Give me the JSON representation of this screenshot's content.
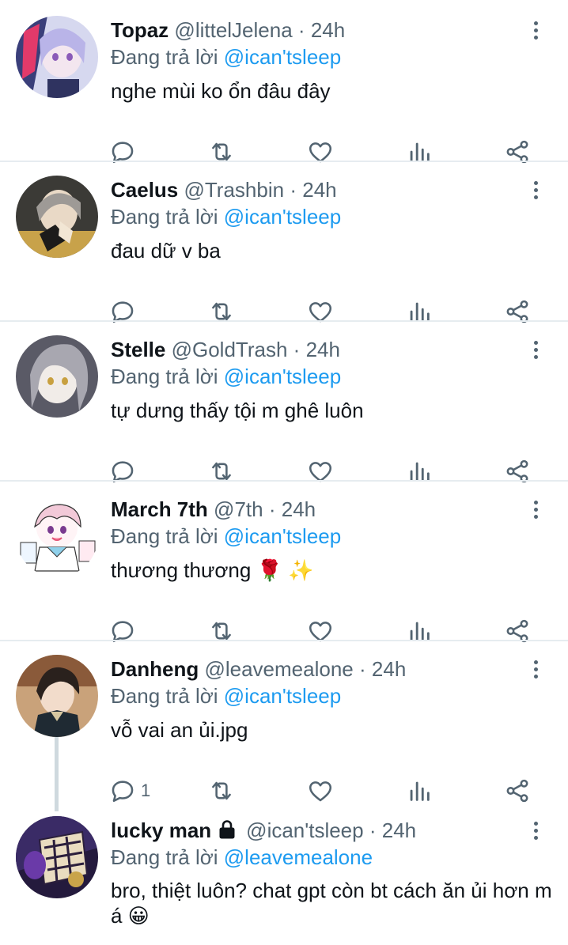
{
  "tweets": [
    {
      "name": "Topaz",
      "handle": "@littelJelena",
      "dot": "·",
      "time": "24h",
      "replying_prefix": "Đang trả lời ",
      "replying_to": "@ican'tsleep",
      "text": "nghe mùi ko ổn đâu đây",
      "reply_count": ""
    },
    {
      "name": "Caelus",
      "handle": "@Trashbin",
      "dot": "·",
      "time": "24h",
      "replying_prefix": "Đang trả lời ",
      "replying_to": "@ican'tsleep",
      "text": "đau dữ v ba",
      "reply_count": ""
    },
    {
      "name": "Stelle",
      "handle": "@GoldTrash",
      "dot": "·",
      "time": "24h",
      "replying_prefix": "Đang trả lời ",
      "replying_to": "@ican'tsleep",
      "text": "tự dưng thấy tội m ghê luôn",
      "reply_count": ""
    },
    {
      "name": "March 7th",
      "handle": "@7th",
      "dot": "·",
      "time": "24h",
      "replying_prefix": "Đang trả lời ",
      "replying_to": "@ican'tsleep",
      "text": "thương thương 🌹 ✨",
      "reply_count": ""
    },
    {
      "name": "Danheng",
      "handle": "@leavemealone",
      "dot": "·",
      "time": "24h",
      "replying_prefix": "Đang trả lời ",
      "replying_to": "@ican'tsleep",
      "text": "vỗ vai an ủi.jpg",
      "reply_count": "1"
    },
    {
      "name": "lucky man",
      "protected": true,
      "handle": "@ican'tsleep",
      "dot": "·",
      "time": "24h",
      "replying_prefix": "Đang trả lời ",
      "replying_to": "@leavemealone",
      "text": "bro, thiệt luôn? chat gpt còn bt cách ăn ủi hơn m á 😀",
      "reply_count": ""
    }
  ],
  "icons": {
    "reply": "reply-icon",
    "retweet": "retweet-icon",
    "like": "heart-icon",
    "views": "views-icon",
    "share": "share-icon",
    "more": "more-icon",
    "lock": "lock-icon"
  },
  "colors": {
    "mention": "#1d9bf0",
    "muted": "#536471",
    "text": "#0f1419",
    "divider": "#e6ecf0",
    "thread_line": "#cfd9de"
  }
}
